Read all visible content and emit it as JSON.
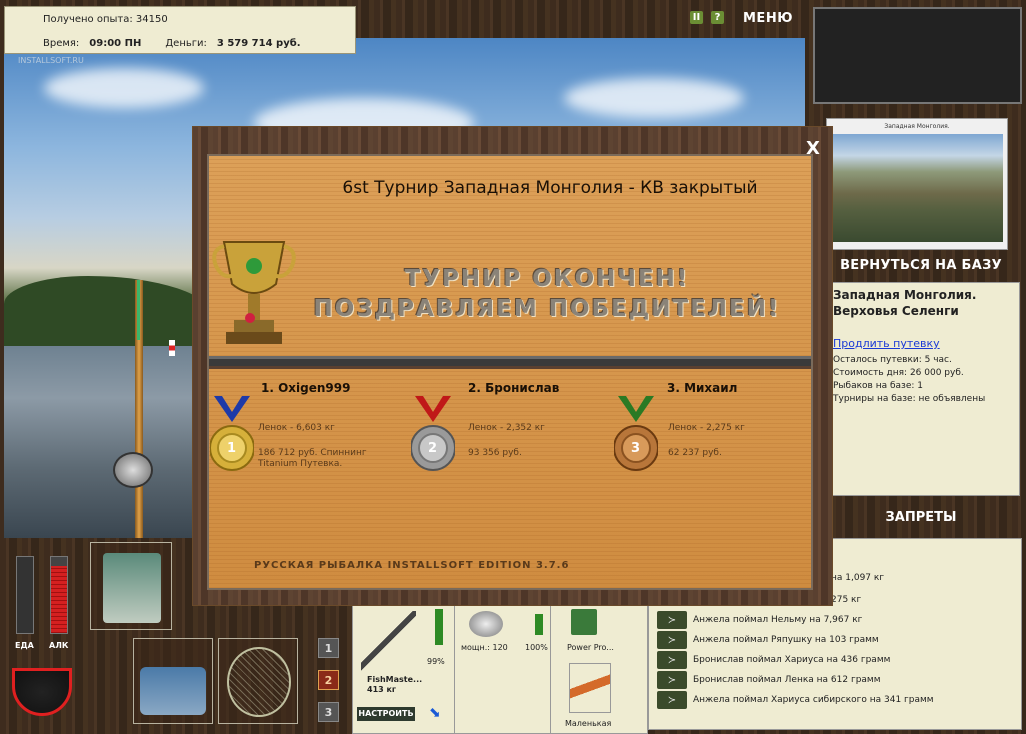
{
  "hud": {
    "exp_label": "Получено опыта: 34150",
    "time_label": "Время:",
    "time_value": "09:00 ПН",
    "money_label": "Деньги:",
    "money_value": "3 579 714 руб.",
    "watermark": "INSTALLSOFT.RU"
  },
  "topbar": {
    "pause": "II",
    "help": "?",
    "menu": "МЕНЮ"
  },
  "right": {
    "photo_caption": "Западная Монголия.",
    "back_to_base": "ВЕРНУТЬСЯ НА БАЗУ",
    "base_title_1": "Западная Монголия.",
    "base_title_2": "Верховья Селенги",
    "extend_link": "Продлить путевку",
    "lines": [
      "Осталось путевки: 5 час.",
      "Стоимость дня: 26 000 руб.",
      "Рыбаков на базе: 1",
      "Турниры на базе: не объявлены"
    ],
    "bans": "ЗАПРЕТЫ"
  },
  "feed": [
    "на 1,097 кг",
    "275 кг",
    "Анжела поймал Нельму на 7,967 кг",
    "Анжела поймал Ряпушку на 103 грамм",
    "Бронислав поймал Хариуса на 436 грамм",
    "Бронислав поймал Ленка на 612 грамм",
    "Анжела поймал Хариуса сибирского на 341 грамм"
  ],
  "left": {
    "food": "ЕДА",
    "alc": "АЛК",
    "slots": [
      "1",
      "2",
      "3"
    ]
  },
  "gear": {
    "rod_name": "FishMaste...",
    "rod_weight": "413 кг",
    "rod_pct": "99%",
    "reel_power": "мощн.: 120",
    "reel_pct": "100%",
    "line_name": "Power Pro...",
    "lure_name": "Маленькая",
    "setup": "НАСТРОИТЬ",
    "rod_level": 0.9,
    "reel_level": 0.7
  },
  "modal": {
    "close": "X",
    "title": "6st Турнир Западная Монголия - КВ закрытый",
    "done_line1": "ТУРНИР ОКОНЧЕН!",
    "done_line2": "ПОЗДРАВЛЯЕМ ПОБЕДИТЕЛЕЙ!",
    "edition": "РУССКАЯ РЫБАЛКА INSTALLSOFT EDITION 3.7.6",
    "winners": [
      {
        "rank": "1",
        "name": "1. Oxigen999",
        "fish": "Ленок - 6,603 кг",
        "prize_1": "186 712 руб. Спиннинг",
        "prize_2": "Titanium Путевка."
      },
      {
        "rank": "2",
        "name": "2. Бронислав",
        "fish": "Ленок - 2,352 кг",
        "prize_1": "93 356 руб.",
        "prize_2": ""
      },
      {
        "rank": "3",
        "name": "3. Михаил",
        "fish": "Ленок - 2,275 кг",
        "prize_1": "62 237 руб.",
        "prize_2": ""
      }
    ]
  }
}
